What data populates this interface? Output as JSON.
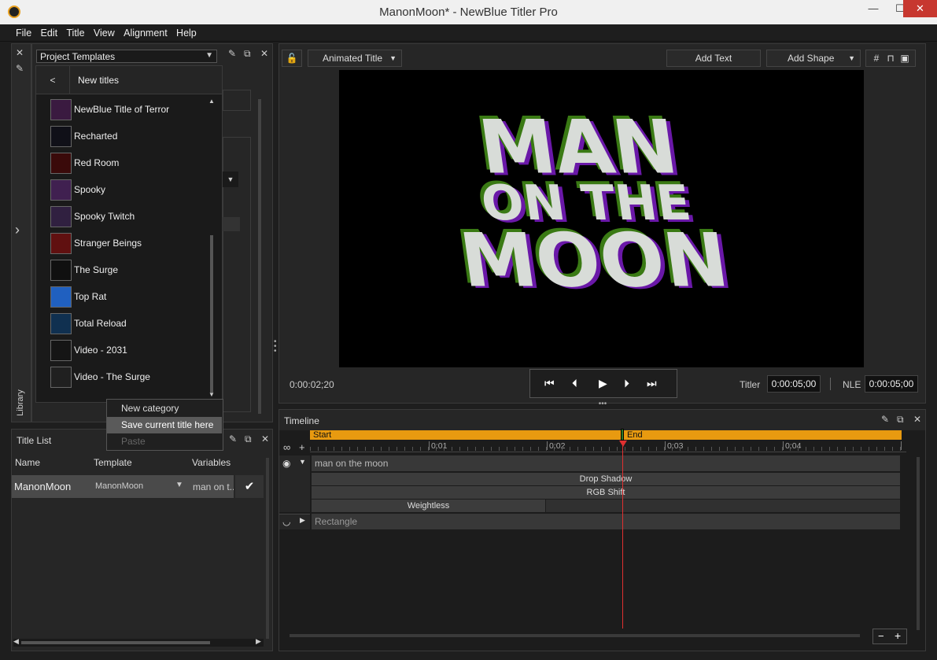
{
  "window": {
    "title": "ManonMoon* - NewBlue Titler Pro",
    "minimize": "—",
    "maximize": "☐",
    "close": "✕"
  },
  "menu": [
    "File",
    "Edit",
    "Title",
    "View",
    "Alignment",
    "Help"
  ],
  "library": {
    "dropdown": "Project Templates",
    "back_label": "<",
    "category": "New titles",
    "side_label": "Library",
    "items": [
      {
        "name": "NewBlue Title of Terror",
        "color": "#3a1a40"
      },
      {
        "name": "Recharted",
        "color": "#101018"
      },
      {
        "name": "Red Room",
        "color": "#3a0a0a"
      },
      {
        "name": "Spooky",
        "color": "#402050"
      },
      {
        "name": "Spooky Twitch",
        "color": "#302040"
      },
      {
        "name": "Stranger Beings",
        "color": "#601010"
      },
      {
        "name": "The Surge",
        "color": "#101010"
      },
      {
        "name": "Top Rat",
        "color": "#2060c0"
      },
      {
        "name": "Total Reload",
        "color": "#103050"
      },
      {
        "name": "Video - 2031",
        "color": "#151515"
      },
      {
        "name": "Video - The Surge",
        "color": "#202020"
      }
    ]
  },
  "context_menu": {
    "items": [
      "New category",
      "Save current title here",
      "Paste"
    ]
  },
  "title_list": {
    "header": "Title List",
    "columns": [
      "Name",
      "Template",
      "Variables"
    ],
    "row": {
      "name": "ManonMoon",
      "template": "ManonMoon",
      "variables": "man  on t..."
    }
  },
  "preview": {
    "mode": "Animated Title",
    "add_text": "Add Text",
    "add_shape": "Add Shape",
    "current_time": "0:00:02;20",
    "titler_label": "Titler",
    "titler_duration": "0:00:05;00",
    "nle_label": "NLE",
    "nle_duration": "0:00:05;00",
    "canvas_lines": [
      "MAN",
      "ON THE",
      "MOON"
    ]
  },
  "timeline": {
    "header": "Timeline",
    "start": "Start",
    "end": "End",
    "ticks": [
      "0:01",
      "0:02",
      "0:03",
      "0:04"
    ],
    "layer1": "man  on the  moon",
    "effects": [
      "Drop Shadow",
      "RGB Shift",
      "Weightless"
    ],
    "layer2": "Rectangle",
    "zoom_minus": "−",
    "zoom_plus": "+"
  }
}
